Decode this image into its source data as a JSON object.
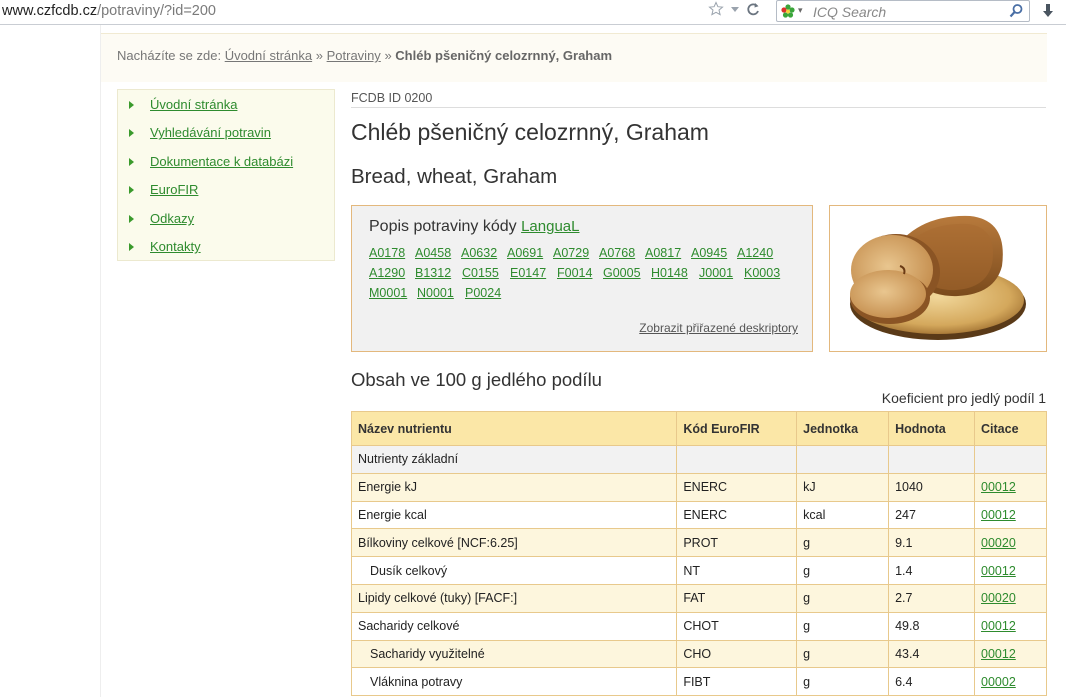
{
  "browser": {
    "url_host": "www.czfcdb.cz",
    "url_path": "/potraviny/?id=200",
    "search_placeholder": "ICQ Search"
  },
  "breadcrumb": {
    "prefix": "Nacházíte se zde:",
    "home": "Úvodní stránka",
    "sep1": "»",
    "section": "Potraviny",
    "sep2": "»",
    "current": "Chléb pšeničný celozrnný, Graham"
  },
  "nav": {
    "items": [
      {
        "label": "Úvodní stránka"
      },
      {
        "label": "Vyhledávání potravin"
      },
      {
        "label": "Dokumentace k databázi"
      },
      {
        "label": "EuroFIR"
      },
      {
        "label": "Odkazy"
      },
      {
        "label": "Kontakty"
      }
    ]
  },
  "food": {
    "fcdb_id": "FCDB ID 0200",
    "name_cz": "Chléb pšeničný celozrnný, Graham",
    "name_en": "Bread, wheat, Graham"
  },
  "langual": {
    "heading": "Popis potraviny kódy",
    "heading_link": "LanguaL",
    "codes": [
      "A0178",
      "A0458",
      "A0632",
      "A0691",
      "A0729",
      "A0768",
      "A0817",
      "A0945",
      "A1240",
      "A1290",
      "B1312",
      "C0155",
      "E0147",
      "F0014",
      "G0005",
      "H0148",
      "J0001",
      "K0003",
      "M0001",
      "N0001",
      "P0024"
    ],
    "show_link": "Zobrazit přiřazené deskriptory"
  },
  "content": {
    "section_title": "Obsah ve 100 g jedlého podílu",
    "coefficient": "Koeficient pro jedlý podíl 1"
  },
  "table": {
    "headers": [
      "Název nutrientu",
      "Kód EuroFIR",
      "Jednotka",
      "Hodnota",
      "Citace"
    ],
    "group": "Nutrienty základní",
    "rows": [
      {
        "name": "Energie kJ",
        "code": "ENERC",
        "unit": "kJ",
        "value": "1040",
        "cite": "00012",
        "indent": false
      },
      {
        "name": "Energie kcal",
        "code": "ENERC",
        "unit": "kcal",
        "value": "247",
        "cite": "00012",
        "indent": false
      },
      {
        "name": "Bílkoviny celkové [NCF:6.25]",
        "code": "PROT",
        "unit": "g",
        "value": "9.1",
        "cite": "00020",
        "indent": false
      },
      {
        "name": "Dusík celkový",
        "code": "NT",
        "unit": "g",
        "value": "1.4",
        "cite": "00012",
        "indent": true
      },
      {
        "name": "Lipidy celkové (tuky) [FACF:]",
        "code": "FAT",
        "unit": "g",
        "value": "2.7",
        "cite": "00020",
        "indent": false
      },
      {
        "name": "Sacharidy celkové",
        "code": "CHOT",
        "unit": "g",
        "value": "49.8",
        "cite": "00012",
        "indent": false
      },
      {
        "name": "Sacharidy využitelné",
        "code": "CHO",
        "unit": "g",
        "value": "43.4",
        "cite": "00012",
        "indent": true
      },
      {
        "name": "Vláknina potravy",
        "code": "FIBT",
        "unit": "g",
        "value": "6.4",
        "cite": "00002",
        "indent": true
      }
    ]
  },
  "colors": {
    "link_green": "#2e8b2e",
    "header_yellow": "#fbe7a7",
    "border_tan": "#e3b87d"
  }
}
